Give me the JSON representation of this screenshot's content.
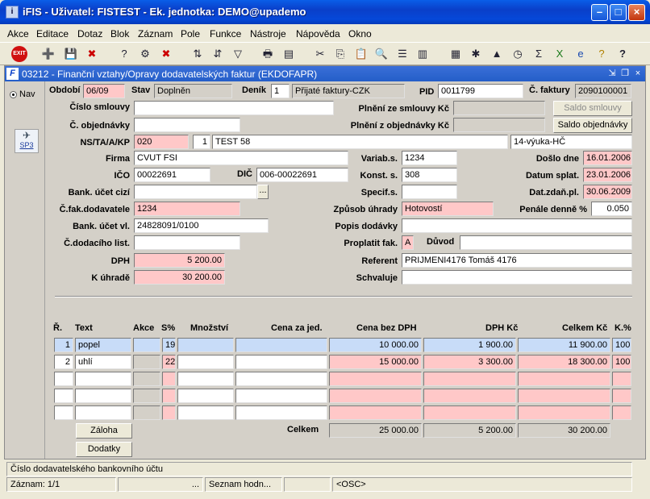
{
  "window": {
    "title": "iFIS - Uživatel: FISTEST - Ek. jednotka: DEMO@upademo"
  },
  "menu": [
    "Akce",
    "Editace",
    "Dotaz",
    "Blok",
    "Záznam",
    "Pole",
    "Funkce",
    "Nástroje",
    "Nápověda",
    "Okno"
  ],
  "form": {
    "title": "03212 - Finanční vztahy/Opravy dodavatelských faktur (EKDOFAPR)",
    "nav_label": "Nav",
    "sp3_label": "SP3"
  },
  "header": {
    "obdobi_label": "Období",
    "obdobi": "06/09",
    "stav_label": "Stav",
    "stav": "Doplněn",
    "denik_label": "Deník",
    "denik_num": "1",
    "denik_name": "Přijaté faktury-CZK",
    "pid_label": "PID",
    "pid": "0011799",
    "cfaktury_label": "Č. faktury",
    "cfaktury": "2090100001"
  },
  "fields": {
    "cislo_smlouvy_label": "Číslo smlouvy",
    "cislo_smlouvy": "",
    "plneni_smlouvy_label": "Plnění ze smlouvy Kč",
    "plneni_smlouvy": "",
    "saldo_smlouvy": "Saldo smlouvy",
    "c_objednavky_label": "Č. objednávky",
    "c_objednavky": "",
    "plneni_objednavky_label": "Plnění z objednávky Kč",
    "plneni_objednavky": "",
    "saldo_objednavky": "Saldo objednávky",
    "ns_label": "NS/TA/A/KP",
    "ns": "020",
    "ta": "1",
    "a": "TEST 58",
    "kp": "14-výuka-HČ",
    "firma_label": "Firma",
    "firma": "CVUT FSI",
    "ico_label": "IČO",
    "ico": "00022691",
    "dic_label": "DIČ",
    "dic": "006-00022691",
    "bank_cizi_label": "Bank. účet cizí",
    "bank_cizi": "",
    "cfak_dod_label": "Č.fak.dodavatele",
    "cfak_dod": "1234",
    "bank_vl_label": "Bank. účet vl.",
    "bank_vl": "24828091/0100",
    "c_dod_list_label": "Č.dodacího list.",
    "c_dod_list": "",
    "dph_label": "DPH",
    "dph": "5 200.00",
    "k_uhrade_label": "K úhradě",
    "k_uhrade": "30 200.00",
    "variab_label": "Variab.s.",
    "variab": "1234",
    "konst_label": "Konst. s.",
    "konst": "308",
    "specif_label": "Specif.s.",
    "specif": "",
    "zpusob_label": "Způsob úhrady",
    "zpusob": "Hotovostí",
    "popis_label": "Popis dodávky",
    "popis": "",
    "proplatit_label": "Proplatit fak.",
    "proplatit": "A",
    "duvod_label": "Důvod",
    "duvod": "",
    "referent_label": "Referent",
    "referent": "PRIJMENI4176 Tomáš 4176",
    "schvaluje_label": "Schvaluje",
    "schvaluje": "",
    "doslo_label": "Došlo dne",
    "doslo": "16.01.2006",
    "splat_label": "Datum splat.",
    "splat": "23.01.2006",
    "zdan_label": "Dat.zdaň.pl.",
    "zdan": "30.06.2009",
    "penale_label": "Penále denně %",
    "penale": "0.050"
  },
  "table": {
    "headers": {
      "r": "Ř.",
      "text": "Text",
      "akce": "Akce",
      "s": "S%",
      "mnozstvi": "Množství",
      "cena_jed": "Cena za jed.",
      "cena_bez": "Cena bez DPH",
      "dph": "DPH Kč",
      "celkem": "Celkem Kč",
      "k": "K.%"
    },
    "rows": [
      {
        "r": "1",
        "text": "popel",
        "akce": "",
        "s": "19",
        "mnozstvi": "",
        "cena_jed": "",
        "cena_bez": "10 000.00",
        "dph": "1 900.00",
        "celkem": "11 900.00",
        "k": "100"
      },
      {
        "r": "2",
        "text": "uhlí",
        "akce": "",
        "s": "22",
        "mnozstvi": "",
        "cena_jed": "",
        "cena_bez": "15 000.00",
        "dph": "3 300.00",
        "celkem": "18 300.00",
        "k": "100"
      },
      {
        "r": "",
        "text": "",
        "akce": "",
        "s": "",
        "mnozstvi": "",
        "cena_jed": "",
        "cena_bez": "",
        "dph": "",
        "celkem": "",
        "k": ""
      },
      {
        "r": "",
        "text": "",
        "akce": "",
        "s": "",
        "mnozstvi": "",
        "cena_jed": "",
        "cena_bez": "",
        "dph": "",
        "celkem": "",
        "k": ""
      },
      {
        "r": "",
        "text": "",
        "akce": "",
        "s": "",
        "mnozstvi": "",
        "cena_jed": "",
        "cena_bez": "",
        "dph": "",
        "celkem": "",
        "k": ""
      }
    ],
    "zaloha": "Záloha",
    "dodatky": "Dodatky",
    "celkem_label": "Celkem",
    "total_bez": "25 000.00",
    "total_dph": "5 200.00",
    "total_celkem": "30 200.00"
  },
  "status": {
    "hint": "Číslo dodavatelského bankovního účtu",
    "zaznam": "Záznam: 1/1",
    "dots": "...",
    "seznam": "Seznam hodn...",
    "osc": "<OSC>"
  },
  "colors": {
    "required": "#ffc8c8",
    "selected_row": "#c8dcf8",
    "titlebar": "#0a5ee8"
  }
}
